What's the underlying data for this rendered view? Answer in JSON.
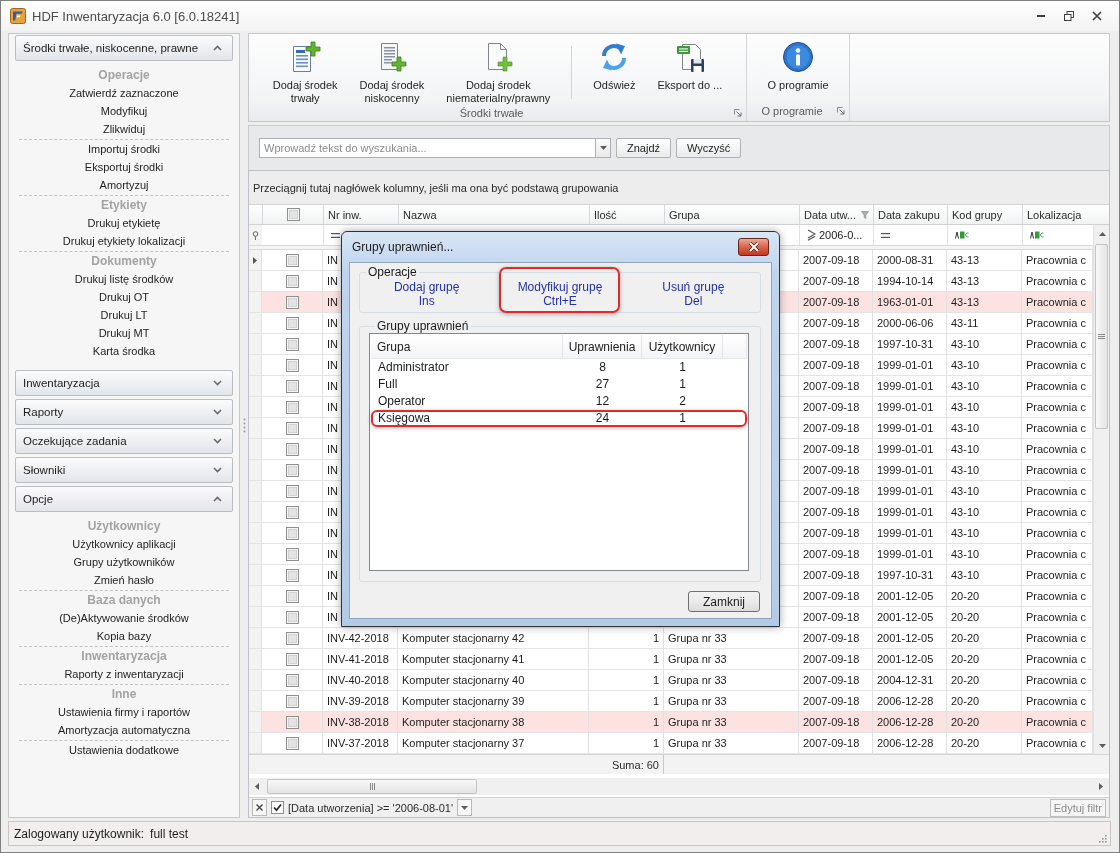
{
  "window": {
    "title": "HDF Inwentaryzacja 6.0 [6.0.18241]"
  },
  "sidebar": {
    "groups": [
      {
        "title": "Środki trwałe, niskocenne, prawne",
        "expanded": true,
        "sections": [
          {
            "heading": "Operacje",
            "items": [
              "Zatwierdź zaznaczone",
              "Modyfikuj",
              "Zlikwiduj"
            ]
          },
          {
            "items": [
              "Importuj środki",
              "Eksportuj środki",
              "Amortyzuj"
            ]
          },
          {
            "heading": "Etykiety",
            "items": [
              "Drukuj etykietę",
              "Drukuj etykiety lokalizacji"
            ]
          },
          {
            "heading": "Dokumenty",
            "items": [
              "Drukuj listę środków",
              "Drukuj OT",
              "Drukuj LT",
              "Drukuj MT",
              "Karta środka"
            ]
          }
        ]
      },
      {
        "title": "Inwentaryzacja",
        "expanded": false
      },
      {
        "title": "Raporty",
        "expanded": false
      },
      {
        "title": "Oczekujące zadania",
        "expanded": false
      },
      {
        "title": "Słowniki",
        "expanded": false
      },
      {
        "title": "Opcje",
        "expanded": true,
        "sections": [
          {
            "heading": "Użytkownicy",
            "items": [
              "Użytkownicy aplikacji",
              "Grupy użytkowników",
              "Zmień hasło"
            ]
          },
          {
            "heading": "Baza danych",
            "items": [
              "(De)Aktywowanie środków",
              "Kopia bazy"
            ]
          },
          {
            "heading": "Inwentaryzacja",
            "items": [
              "Raporty z inwentaryzacji"
            ]
          },
          {
            "heading": "Inne",
            "items": [
              "Ustawienia firmy i raportów",
              "Amortyzacja automatyczna"
            ]
          },
          {
            "items": [
              "Ustawienia dodatkowe"
            ]
          }
        ]
      }
    ]
  },
  "ribbon": {
    "groups": [
      {
        "label": "Środki trwałe",
        "launcher": true,
        "items": [
          {
            "kind": "add_fixed_asset",
            "label": "Dodaj środek\ntrwały"
          },
          {
            "kind": "add_low_value_asset",
            "label": "Dodaj środek\nniskocenny"
          },
          {
            "kind": "add_intangible_asset",
            "label": "Dodaj środek\nniematerialny/prawny"
          },
          {
            "kind": "separator"
          },
          {
            "kind": "refresh",
            "label": "Odśwież"
          },
          {
            "kind": "export",
            "label": "Eksport do ..."
          }
        ]
      },
      {
        "label": "O programie",
        "launcher": true,
        "items": [
          {
            "kind": "about",
            "label": "O programie"
          }
        ]
      }
    ]
  },
  "search": {
    "placeholder": "Wprowadź tekst do wyszukania...",
    "buttons": [
      "Znajdź",
      "Wyczyść"
    ]
  },
  "grid": {
    "group_panel_hint": "Przeciągnij tutaj nagłówek kolumny, jeśli ma ona być podstawą grupowania",
    "select_all_checked": false,
    "columns": [
      {
        "label": "Nr inw.",
        "filtered": false
      },
      {
        "label": "Nazwa",
        "filtered": false
      },
      {
        "label": "Ilość",
        "filtered": false
      },
      {
        "label": "Grupa",
        "filtered": false
      },
      {
        "label": "Data utw...",
        "filtered": true
      },
      {
        "label": "Data zakupu",
        "filtered": false
      },
      {
        "label": "Kod grupy",
        "filtered": false
      },
      {
        "label": "Lokalizacja",
        "filtered": false
      }
    ],
    "filter_row": {
      "nr_inw": {
        "kind": "equals"
      },
      "data_utworzenia": {
        "kind": "greater_or_equal",
        "value": "2006-0..."
      },
      "data_zakupu": {
        "kind": "equals"
      },
      "kod_grupy": {
        "kind": "text"
      },
      "lokalizacja": {
        "kind": "text"
      }
    },
    "rows": [
      {
        "focused": true,
        "highlighted": false,
        "checked": false,
        "nr_inw": "IN",
        "data_utworzenia": "2007-09-18",
        "data_zakupu": "2000-08-31",
        "kod_grupy": "43-13",
        "lokalizacja": "Pracownia c"
      },
      {
        "focused": false,
        "highlighted": false,
        "checked": false,
        "nr_inw": "IN",
        "data_utworzenia": "2007-09-18",
        "data_zakupu": "1994-10-14",
        "kod_grupy": "43-13",
        "lokalizacja": "Pracownia c"
      },
      {
        "focused": false,
        "highlighted": true,
        "checked": false,
        "nr_inw": "IN",
        "data_utworzenia": "2007-09-18",
        "data_zakupu": "1963-01-01",
        "kod_grupy": "43-13",
        "lokalizacja": "Pracownia c"
      },
      {
        "focused": false,
        "highlighted": false,
        "checked": false,
        "nr_inw": "IN",
        "data_utworzenia": "2007-09-18",
        "data_zakupu": "2000-06-06",
        "kod_grupy": "43-11",
        "lokalizacja": "Pracownia c"
      },
      {
        "focused": false,
        "highlighted": false,
        "checked": false,
        "nr_inw": "IN",
        "data_utworzenia": "2007-09-18",
        "data_zakupu": "1997-10-31",
        "kod_grupy": "43-10",
        "lokalizacja": "Pracownia c"
      },
      {
        "focused": false,
        "highlighted": false,
        "checked": false,
        "nr_inw": "IN",
        "data_utworzenia": "2007-09-18",
        "data_zakupu": "1999-01-01",
        "kod_grupy": "43-10",
        "lokalizacja": "Pracownia c"
      },
      {
        "focused": false,
        "highlighted": false,
        "checked": false,
        "nr_inw": "IN",
        "data_utworzenia": "2007-09-18",
        "data_zakupu": "1999-01-01",
        "kod_grupy": "43-10",
        "lokalizacja": "Pracownia c"
      },
      {
        "focused": false,
        "highlighted": false,
        "checked": false,
        "nr_inw": "IN",
        "data_utworzenia": "2007-09-18",
        "data_zakupu": "1999-01-01",
        "kod_grupy": "43-10",
        "lokalizacja": "Pracownia c"
      },
      {
        "focused": false,
        "highlighted": false,
        "checked": false,
        "nr_inw": "IN",
        "data_utworzenia": "2007-09-18",
        "data_zakupu": "1999-01-01",
        "kod_grupy": "43-10",
        "lokalizacja": "Pracownia c"
      },
      {
        "focused": false,
        "highlighted": false,
        "checked": false,
        "nr_inw": "IN",
        "data_utworzenia": "2007-09-18",
        "data_zakupu": "1999-01-01",
        "kod_grupy": "43-10",
        "lokalizacja": "Pracownia c"
      },
      {
        "focused": false,
        "highlighted": false,
        "checked": false,
        "nr_inw": "IN",
        "data_utworzenia": "2007-09-18",
        "data_zakupu": "1999-01-01",
        "kod_grupy": "43-10",
        "lokalizacja": "Pracownia c"
      },
      {
        "focused": false,
        "highlighted": false,
        "checked": false,
        "nr_inw": "IN",
        "data_utworzenia": "2007-09-18",
        "data_zakupu": "1999-01-01",
        "kod_grupy": "43-10",
        "lokalizacja": "Pracownia c"
      },
      {
        "focused": false,
        "highlighted": false,
        "checked": false,
        "nr_inw": "IN",
        "data_utworzenia": "2007-09-18",
        "data_zakupu": "1999-01-01",
        "kod_grupy": "43-10",
        "lokalizacja": "Pracownia c"
      },
      {
        "focused": false,
        "highlighted": false,
        "checked": false,
        "nr_inw": "IN",
        "data_utworzenia": "2007-09-18",
        "data_zakupu": "1999-01-01",
        "kod_grupy": "43-10",
        "lokalizacja": "Pracownia c"
      },
      {
        "focused": false,
        "highlighted": false,
        "checked": false,
        "nr_inw": "IN",
        "data_utworzenia": "2007-09-18",
        "data_zakupu": "1999-01-01",
        "kod_grupy": "43-10",
        "lokalizacja": "Pracownia c"
      },
      {
        "focused": false,
        "highlighted": false,
        "checked": false,
        "nr_inw": "IN",
        "data_utworzenia": "2007-09-18",
        "data_zakupu": "1997-10-31",
        "kod_grupy": "43-10",
        "lokalizacja": "Pracownia c"
      },
      {
        "focused": false,
        "highlighted": false,
        "checked": false,
        "nr_inw": "IN",
        "data_utworzenia": "2007-09-18",
        "data_zakupu": "2001-12-05",
        "kod_grupy": "20-20",
        "lokalizacja": "Pracownia c"
      },
      {
        "focused": false,
        "highlighted": false,
        "checked": false,
        "nr_inw": "IN",
        "data_utworzenia": "2007-09-18",
        "data_zakupu": "2001-12-05",
        "kod_grupy": "20-20",
        "lokalizacja": "Pracownia c"
      },
      {
        "focused": false,
        "highlighted": false,
        "checked": false,
        "nr_inw": "INV-42-2018",
        "nazwa": "Komputer stacjonarny 42",
        "ilosc": "1",
        "grupa": "Grupa nr 33",
        "data_utworzenia": "2007-09-18",
        "data_zakupu": "2001-12-05",
        "kod_grupy": "20-20",
        "lokalizacja": "Pracownia c"
      },
      {
        "focused": false,
        "highlighted": false,
        "checked": false,
        "nr_inw": "INV-41-2018",
        "nazwa": "Komputer stacjonarny 41",
        "ilosc": "1",
        "grupa": "Grupa nr 33",
        "data_utworzenia": "2007-09-18",
        "data_zakupu": "2001-12-05",
        "kod_grupy": "20-20",
        "lokalizacja": "Pracownia c"
      },
      {
        "focused": false,
        "highlighted": false,
        "checked": false,
        "nr_inw": "INV-40-2018",
        "nazwa": "Komputer stacjonarny 40",
        "ilosc": "1",
        "grupa": "Grupa nr 33",
        "data_utworzenia": "2007-09-18",
        "data_zakupu": "2004-12-31",
        "kod_grupy": "20-20",
        "lokalizacja": "Pracownia c"
      },
      {
        "focused": false,
        "highlighted": false,
        "checked": false,
        "nr_inw": "INV-39-2018",
        "nazwa": "Komputer stacjonarny 39",
        "ilosc": "1",
        "grupa": "Grupa nr 33",
        "data_utworzenia": "2007-09-18",
        "data_zakupu": "2006-12-28",
        "kod_grupy": "20-20",
        "lokalizacja": "Pracownia c"
      },
      {
        "focused": false,
        "highlighted": true,
        "checked": false,
        "nr_inw": "INV-38-2018",
        "nazwa": "Komputer stacjonarny 38",
        "ilosc": "1",
        "grupa": "Grupa nr 33",
        "data_utworzenia": "2007-09-18",
        "data_zakupu": "2006-12-28",
        "kod_grupy": "20-20",
        "lokalizacja": "Pracownia c"
      },
      {
        "focused": false,
        "highlighted": false,
        "checked": false,
        "nr_inw": "INV-37-2018",
        "nazwa": "Komputer stacjonarny 37",
        "ilosc": "1",
        "grupa": "Grupa nr 33",
        "data_utworzenia": "2007-09-18",
        "data_zakupu": "2006-12-28",
        "kod_grupy": "20-20",
        "lokalizacja": "Pracownia c"
      }
    ],
    "footer": {
      "ilosc": "Suma: 60"
    },
    "filter_panel": {
      "enabled": true,
      "expression": "[Data utworzenia] >= '2006-08-01'",
      "edit_button": {
        "label": "Edytuj filtr",
        "disabled": true
      }
    }
  },
  "dialog": {
    "title": "Grupy uprawnień...",
    "operations": {
      "label": "Operacje",
      "actions": [
        {
          "label": "Dodaj grupę",
          "shortcut": "Ins",
          "highlighted": false
        },
        {
          "label": "Modyfikuj grupę",
          "shortcut": "Ctrl+E",
          "highlighted": true
        },
        {
          "label": "Usuń grupę",
          "shortcut": "Del",
          "highlighted": false
        }
      ]
    },
    "groups_box": {
      "label": "Grupy uprawnień",
      "columns": [
        "Grupa",
        "Uprawnienia",
        "Użytkownicy"
      ],
      "rows": [
        {
          "grupa": "Administrator",
          "uprawnienia": "8",
          "uzytkownicy": "1",
          "highlighted": false
        },
        {
          "grupa": "Full",
          "uprawnienia": "27",
          "uzytkownicy": "1",
          "highlighted": false
        },
        {
          "grupa": "Operator",
          "uprawnienia": "12",
          "uzytkownicy": "2",
          "highlighted": false
        },
        {
          "grupa": "Księgowa",
          "uprawnienia": "24",
          "uzytkownicy": "1",
          "highlighted": true
        }
      ]
    },
    "close_button": "Zamknij"
  },
  "status_bar": {
    "label": "Zalogowany użytkownik:",
    "value": "full test"
  }
}
